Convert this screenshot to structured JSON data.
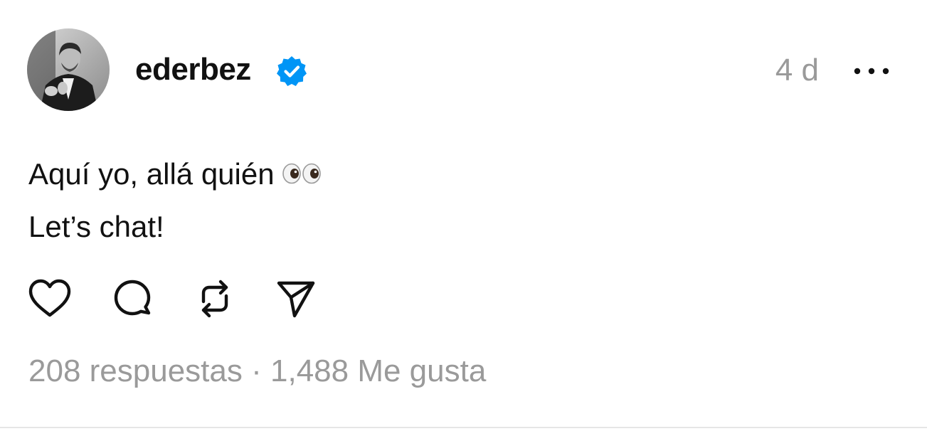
{
  "post": {
    "username": "ederbez",
    "timestamp": "4 d",
    "text_lines": [
      "Aquí yo, allá quién",
      "Let’s chat!"
    ],
    "emoji_icon": "eyes-emoji-icon",
    "stats": {
      "replies": "208 respuestas",
      "separator": "·",
      "likes": "1,488 Me gusta"
    }
  },
  "icons": {
    "verified": "verified-badge-icon",
    "more": "more-options-icon",
    "like": "heart-icon",
    "reply": "comment-icon",
    "repost": "repost-icon",
    "share": "send-icon"
  },
  "colors": {
    "verified_blue": "#0095F6",
    "muted_text": "#9a9a9a",
    "text": "#111111",
    "divider": "#e6e6e6"
  }
}
